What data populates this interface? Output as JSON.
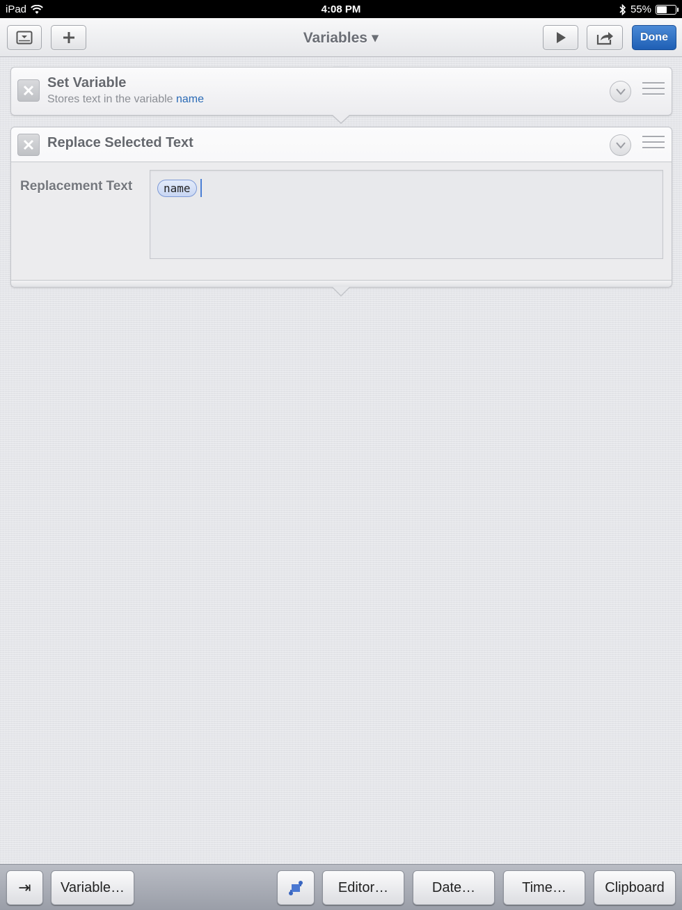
{
  "status_bar": {
    "device": "iPad",
    "time": "4:08 PM",
    "battery_percent": "55%",
    "battery_level": 0.55
  },
  "nav": {
    "title": "Variables ▾",
    "done_label": "Done",
    "icons": [
      "list-toggle-icon",
      "plus-icon",
      "play-icon",
      "share-icon"
    ]
  },
  "actions": [
    {
      "title": "Set Variable",
      "subtitle_prefix": "Stores text in the variable",
      "subtitle_variable": "name"
    },
    {
      "title": "Replace Selected Text",
      "field_label": "Replacement Text",
      "token": "name"
    }
  ],
  "keyboard_bar": {
    "tab_key": "⇥",
    "variable": "Variable…",
    "editor": "Editor…",
    "date": "Date…",
    "time": "Time…",
    "clipboard": "Clipboard"
  },
  "colors": {
    "accent": "#1f5fb5",
    "variable_link": "#2a6ab5",
    "token_border": "#7d99d6"
  }
}
